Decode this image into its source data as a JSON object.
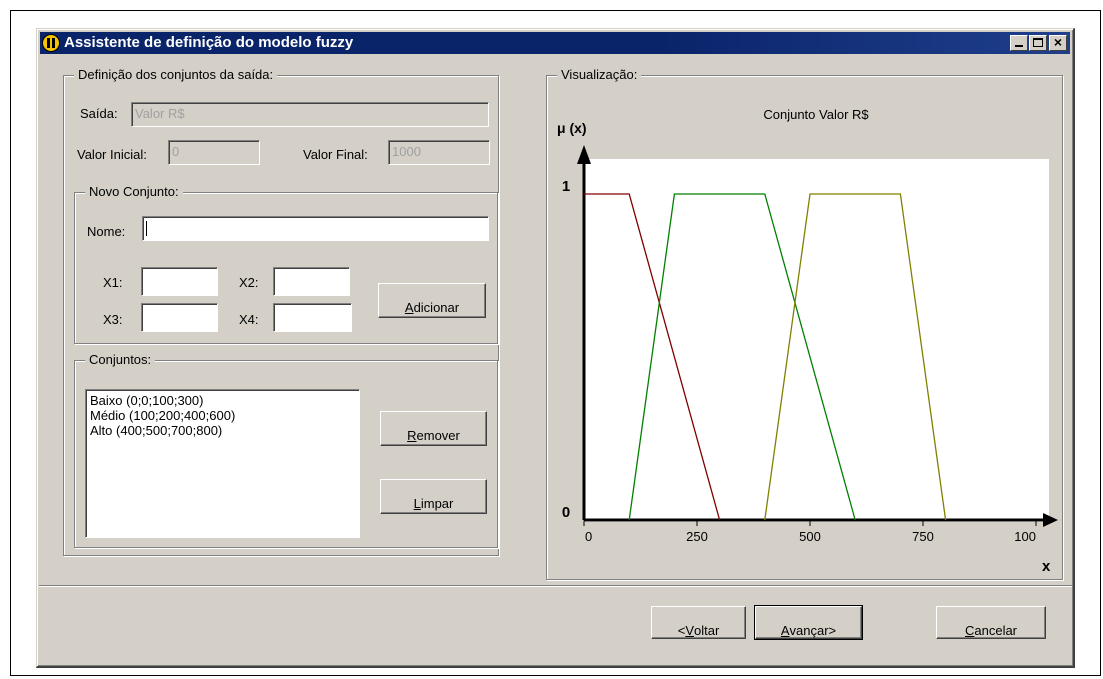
{
  "window": {
    "title": "Assistente de definição do modelo fuzzy",
    "close_glyph": "×"
  },
  "output_group": {
    "title": "Definição dos conjuntos da saída:",
    "output_label": "Saída:",
    "output_value": "Valor R$",
    "initial_label": "Valor Inicial:",
    "initial_value": "0",
    "final_label": "Valor Final:",
    "final_value": "1000"
  },
  "new_set_group": {
    "title": "Novo Conjunto:",
    "name_label": "Nome:",
    "name_value": "",
    "x1_label": "X1:",
    "x2_label": "X2:",
    "x3_label": "X3:",
    "x4_label": "X4:",
    "x1_value": "",
    "x2_value": "",
    "x3_value": "",
    "x4_value": "",
    "add_button": {
      "accel": "A",
      "rest": "dicionar"
    }
  },
  "sets_group": {
    "title": "Conjuntos:",
    "items": [
      "Baixo (0;0;100;300)",
      "Médio (100;200;400;600)",
      "Alto (400;500;700;800)"
    ],
    "remove_button": {
      "accel": "R",
      "rest": "emover"
    },
    "clear_button": {
      "accel": "L",
      "rest": "impar"
    }
  },
  "visual_group": {
    "title": "Visualização:"
  },
  "footer": {
    "back_button": {
      "prefix": "< ",
      "accel": "V",
      "rest": "oltar"
    },
    "next_button": {
      "accel": "A",
      "rest": "vançar>"
    },
    "cancel_button": {
      "accel": "C",
      "rest": "ancelar"
    }
  },
  "chart_data": {
    "type": "line",
    "title": "Conjunto Valor R$",
    "ylabel": "μ (x)",
    "xlabel": "x",
    "xlim": [
      0,
      1000
    ],
    "ylim": [
      0,
      1
    ],
    "x_ticks": [
      0,
      250,
      500,
      750,
      1000
    ],
    "x_tick_labels": [
      "0",
      "250",
      "500",
      "750",
      "100"
    ],
    "y_ticks": [
      0,
      1
    ],
    "y_tick_labels": [
      "0",
      "1"
    ],
    "grid": false,
    "series": [
      {
        "color": "#800000",
        "x": [
          0,
          100,
          300
        ],
        "y": [
          1,
          1,
          0
        ]
      },
      {
        "color": "#008000",
        "x": [
          100,
          200,
          400,
          600
        ],
        "y": [
          0,
          1,
          1,
          0
        ]
      },
      {
        "color": "#808000",
        "x": [
          400,
          500,
          700,
          800
        ],
        "y": [
          0,
          1,
          1,
          0
        ]
      }
    ]
  }
}
